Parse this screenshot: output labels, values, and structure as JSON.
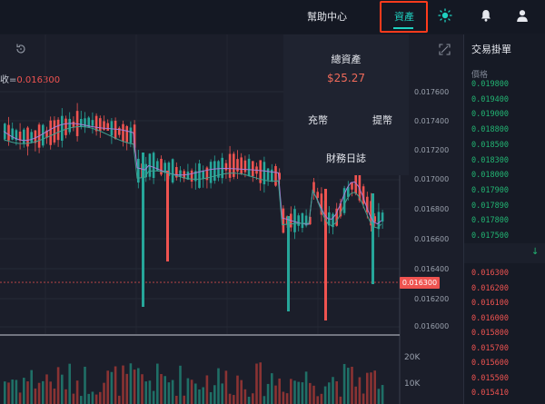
{
  "nav": {
    "help": "幫助中心",
    "assets": "資產",
    "icons": {
      "theme": "sun-icon",
      "notifications": "bell-icon",
      "account": "user-icon"
    },
    "accent_color": "#1fd1c0",
    "highlight_color": "#ff3b1c"
  },
  "chart": {
    "indicator_label": "收=",
    "indicator_value": "0.016300",
    "current_price": "0.016300",
    "price_axis": [
      "0.017600",
      "0.017400",
      "0.017200",
      "0.017000",
      "0.016800",
      "0.016600",
      "0.016400",
      "0.016200",
      "0.016000"
    ],
    "volume_axis": [
      "20K",
      "10K"
    ],
    "colors": {
      "up": "#26a69a",
      "down": "#ef5350",
      "ma_fast": "#a67cd6",
      "ma_slow": "#3fa08f"
    }
  },
  "assets_popup": {
    "title": "總資產",
    "total": "$25.27",
    "deposit": "充幣",
    "withdraw": "提幣",
    "finance_log": "財務日誌"
  },
  "orderbook": {
    "title": "交易掛單",
    "price_header": "價格",
    "bids": [
      "0.019800",
      "0.019400",
      "0.019000",
      "0.018800",
      "0.018500",
      "0.018300",
      "0.018000",
      "0.017900",
      "0.017890",
      "0.017800",
      "0.017500"
    ],
    "asks": [
      "0.016300",
      "0.016200",
      "0.016100",
      "0.016000",
      "0.015800",
      "0.015700",
      "0.015600",
      "0.015500",
      "0.015410"
    ]
  }
}
